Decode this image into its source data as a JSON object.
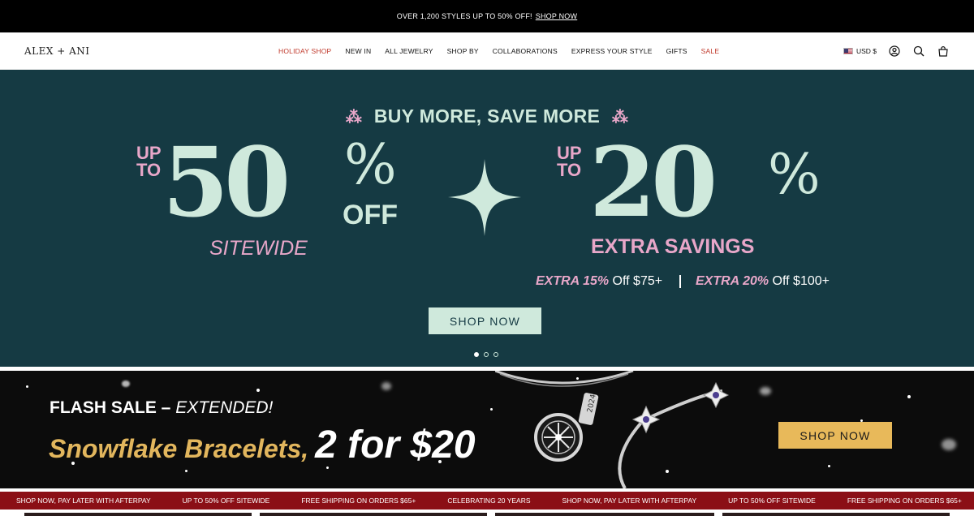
{
  "announcement": {
    "text": "OVER 1,200 STYLES UP TO 50% OFF!",
    "link": "SHOP NOW"
  },
  "header": {
    "logo": "ALEX + ANI",
    "nav": [
      "HOLIDAY SHOP",
      "NEW IN",
      "ALL JEWELRY",
      "SHOP BY",
      "COLLABORATIONS",
      "EXPRESS YOUR STYLE",
      "GIFTS",
      "SALE"
    ],
    "currency": "USD $",
    "icons": [
      "account-icon",
      "search-icon",
      "cart-icon"
    ]
  },
  "hero": {
    "headline": "BUY MORE, SAVE MORE",
    "left": {
      "upto": "UP",
      "to": "TO",
      "number": "50",
      "percent": "%",
      "off": "OFF",
      "sub": "SITEWIDE"
    },
    "right": {
      "upto": "UP",
      "to": "TO",
      "number": "20",
      "percent": "%",
      "sub": "EXTRA SAVINGS"
    },
    "tier1_bold": "EXTRA 15%",
    "tier1_rest": " Off $75+",
    "tier2_bold": "EXTRA 20%",
    "tier2_rest": " Off $100+",
    "cta": "SHOP NOW",
    "slides_total": 3,
    "slide_active": 1
  },
  "flash": {
    "title_bold": "FLASH SALE – ",
    "title_italic": "EXTENDED!",
    "product": "Snowflake Bracelets,",
    "price": "2 for $20",
    "cta": "SHOP NOW",
    "charm_text": "2024"
  },
  "marquee": [
    "SHOP NOW, PAY LATER WITH AFTERPAY",
    "UP TO 50% OFF SITEWIDE",
    "FREE SHIPPING ON ORDERS $65+",
    "CELEBRATING 20 YEARS",
    "SHOP NOW, PAY LATER WITH AFTERPAY",
    "UP TO 50% OFF SITEWIDE",
    "FREE SHIPPING ON ORDERS $65+"
  ],
  "colors": {
    "hero_bg": "#153a43",
    "mint": "#cfe9dc",
    "pink": "#e8a7c9",
    "gold": "#e2b65d",
    "marquee_bg": "#8b0f16",
    "sale_red": "#c0392b"
  }
}
